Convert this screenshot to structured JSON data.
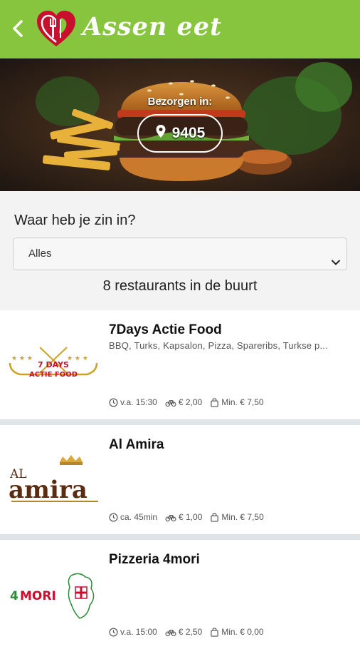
{
  "header": {
    "back_icon": "chevron-left-icon",
    "logo_icon": "heart-fork-logo-icon",
    "brand": "Assen eet",
    "colors": {
      "bar": "#86c53d",
      "heart": "#c8102e"
    }
  },
  "hero": {
    "image": "burger-and-fries-photo",
    "deliver_label": "Bezorgen in:",
    "location_icon": "map-pin-icon",
    "zip": "9405"
  },
  "filter": {
    "question": "Waar heb je zin in?",
    "selected": "Alles",
    "chevron_icon": "chevron-down-icon"
  },
  "results": {
    "count_text": "8 restaurants in de buurt"
  },
  "restaurants": [
    {
      "name": "7Days Actie Food",
      "cuisine": "BBQ, Turks, Kapsalon, Pizza, Spareribs, Turkse p...",
      "logo_text": "7 DAYS ACTIE FOOD",
      "time": "v.a. 15:30",
      "delivery_cost": "€ 2,00",
      "min_order": "Min. € 7,50"
    },
    {
      "name": "Al Amira",
      "cuisine": "",
      "logo_text": "AL amira",
      "time": "ca. 45min",
      "delivery_cost": "€ 1,00",
      "min_order": "Min. € 7,50"
    },
    {
      "name": "Pizzeria 4mori",
      "cuisine": "",
      "logo_text": "4 MORI",
      "time": "v.a. 15:00",
      "delivery_cost": "€ 2,50",
      "min_order": "Min. € 0,00"
    }
  ],
  "meta_icons": [
    "clock-icon",
    "bicycle-icon",
    "shopping-bag-icon"
  ]
}
